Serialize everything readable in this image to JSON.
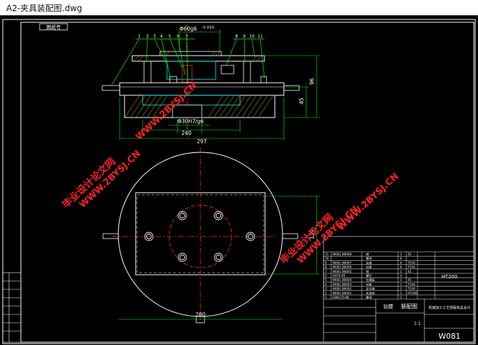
{
  "window": {
    "title": "A2-夹具装配图.dwg"
  },
  "drawing": {
    "stamp_label": "图纸号",
    "dims": {
      "top_fit": "Φ60g6",
      "top_tol": "-0.010",
      "height_96": "96",
      "height_45": "45",
      "bore_fit": "Φ30H7/g6",
      "width_240": "240",
      "width_297": "297",
      "side_130": "130",
      "bottom_280": "280"
    },
    "balloons": [
      "1",
      "2",
      "3",
      "4",
      "5",
      "6",
      "7",
      "8",
      "9",
      "10",
      "11"
    ],
    "watermark": {
      "site": "WWW.2BYSJ.CN",
      "cn": "毕业设计论文网"
    },
    "title_block": {
      "drawing_name": "装配图",
      "part_label": "钻模",
      "school": "机械加工工艺规程夹具设计",
      "material": "HT200",
      "code": "W081",
      "scale": "1:1",
      "rows": [
        {
          "no": "11",
          "code": "W081-JW008",
          "name": "销",
          "qty": "1",
          "mat": "45"
        },
        {
          "no": "10",
          "code": "",
          "name": "螺母",
          "qty": "6",
          "mat": ""
        },
        {
          "no": "9",
          "code": "W081-JW007",
          "name": "钻套",
          "qty": "6",
          "mat": "T10A"
        },
        {
          "no": "8",
          "code": "W081-JW006",
          "name": "衬套",
          "qty": "6",
          "mat": "T10A"
        },
        {
          "no": "7",
          "code": "W081-JW005",
          "name": "销",
          "qty": "1",
          "mat": "45"
        },
        {
          "no": "6",
          "code": "GB70-85",
          "name": "螺钉",
          "qty": "4",
          "mat": ""
        },
        {
          "no": "5",
          "code": "W081-JW004",
          "name": "钻模板",
          "qty": "1",
          "mat": "45"
        },
        {
          "no": "4",
          "code": "W081-JW003",
          "name": "衬套",
          "qty": "1",
          "mat": "T10A"
        },
        {
          "no": "3",
          "code": "W081-JW002",
          "name": "定位销",
          "qty": "1",
          "mat": "T10A"
        },
        {
          "no": "2",
          "code": "W081-JW001",
          "name": "夹具体",
          "qty": "1",
          "mat": "HT200"
        },
        {
          "no": "1",
          "code": "GB6170-86",
          "name": "螺母",
          "qty": "1",
          "mat": ""
        }
      ]
    }
  }
}
